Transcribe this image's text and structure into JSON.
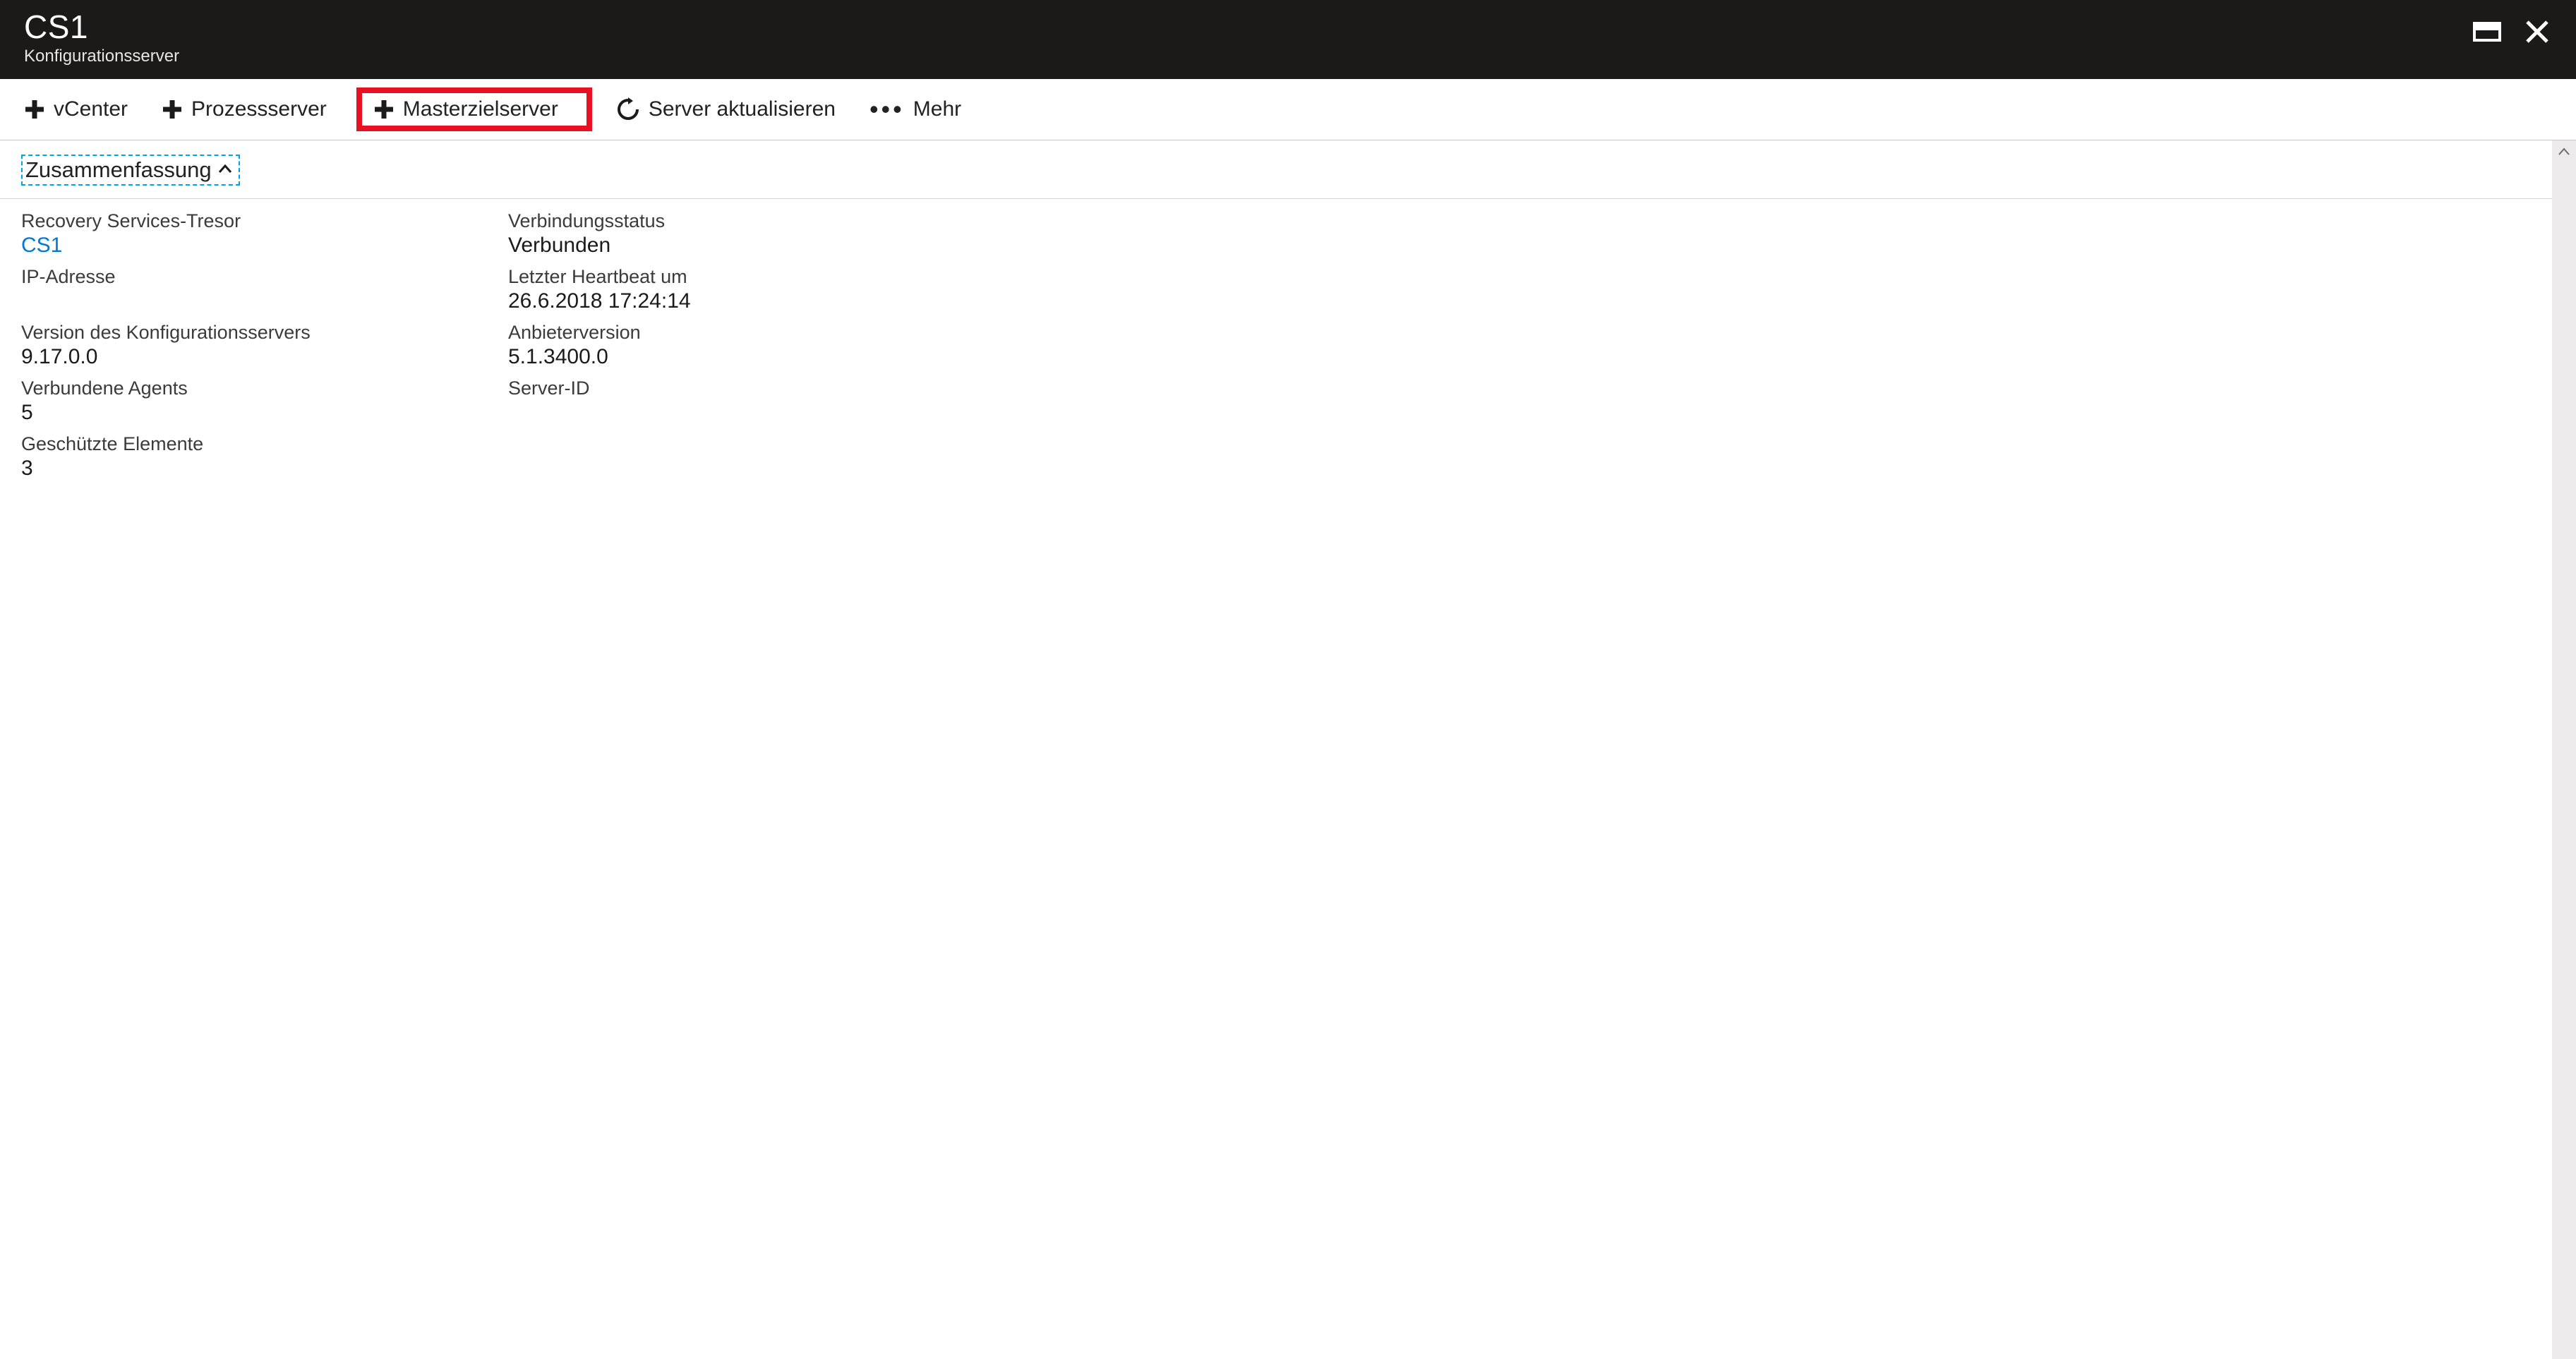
{
  "header": {
    "title": "CS1",
    "subtitle": "Konfigurationsserver"
  },
  "toolbar": {
    "vcenter": "vCenter",
    "process_server": "Prozessserver",
    "master_target": "Masterzielserver",
    "refresh": "Server aktualisieren",
    "more": "Mehr"
  },
  "section": {
    "summary_title": "Zusammenfassung"
  },
  "summary": {
    "left": [
      {
        "label": "Recovery Services-Tresor",
        "value": "CS1",
        "link": true
      },
      {
        "label": "IP-Adresse",
        "value": ""
      },
      {
        "label": "Version des Konfigurationsservers",
        "value": "9.17.0.0"
      },
      {
        "label": "Verbundene Agents",
        "value": "5"
      },
      {
        "label": "Geschützte Elemente",
        "value": "3"
      }
    ],
    "right": [
      {
        "label": "Verbindungsstatus",
        "value": "Verbunden"
      },
      {
        "label": "Letzter Heartbeat um",
        "value": "26.6.2018 17:24:14"
      },
      {
        "label": "Anbieterversion",
        "value": "5.1.3400.0"
      },
      {
        "label": "Server-ID",
        "value": ""
      }
    ]
  }
}
